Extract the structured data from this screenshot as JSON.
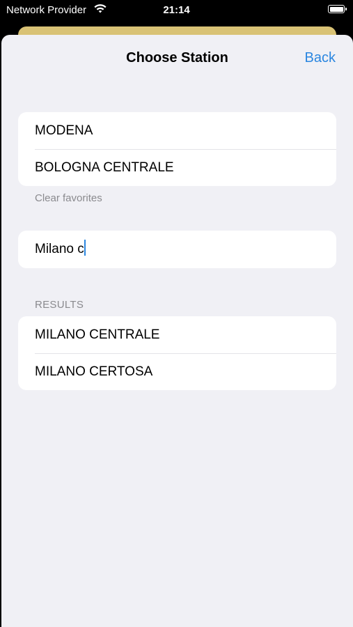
{
  "status_bar": {
    "carrier": "Network Provider",
    "time": "21:14",
    "wifi_icon": "wifi-icon",
    "battery_icon": "battery-icon"
  },
  "nav": {
    "title": "Choose Station",
    "back_label": "Back",
    "accent_color": "#2a86e0"
  },
  "favorites": {
    "items": [
      {
        "label": "MODENA"
      },
      {
        "label": "BOLOGNA CENTRALE"
      }
    ],
    "clear_label": "Clear favorites"
  },
  "search": {
    "value": "Milano c"
  },
  "results": {
    "header": "RESULTS",
    "items": [
      {
        "label": "MILANO CENTRALE"
      },
      {
        "label": "MILANO CERTOSA"
      }
    ]
  }
}
